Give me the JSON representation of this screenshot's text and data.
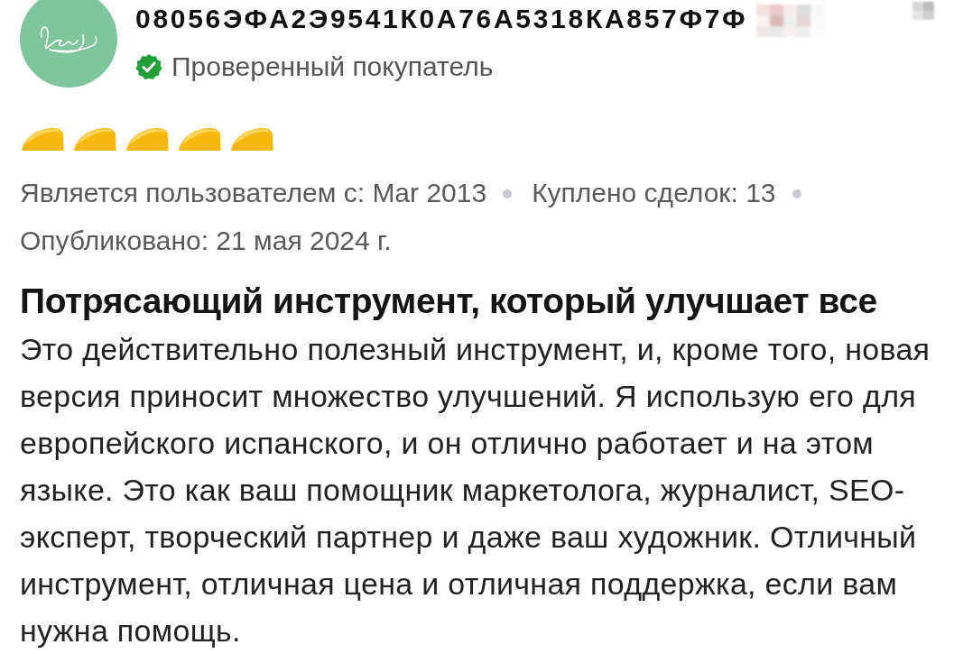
{
  "reviewer": {
    "name": "08056ЭФА2Э9541К0А76А5318КА857Ф7Ф",
    "verified": true,
    "status": "Проверенный покупатель"
  },
  "rating": {
    "stars": 5
  },
  "meta": [
    "Является пользователем с: Mar 2013",
    "Куплено сделок: 13"
  ],
  "published": "Опубликовано: 21 мая 2024 г.",
  "review": {
    "title": "Потрясающий инструмент, который улучшает все",
    "text": "Это действительно полезный инструмент, и, кроме того, новая версия приносит множество улучшений. Я использую его для европейского испанского, и он отлично работает и на этом языке. Это как ваш помощник маркетолога, журналист, SEO-эксперт, творческий партнер и даже ваш художник. Отличный инструмент, отличная цена и отличная поддержка, если вам нужна помощь."
  }
}
